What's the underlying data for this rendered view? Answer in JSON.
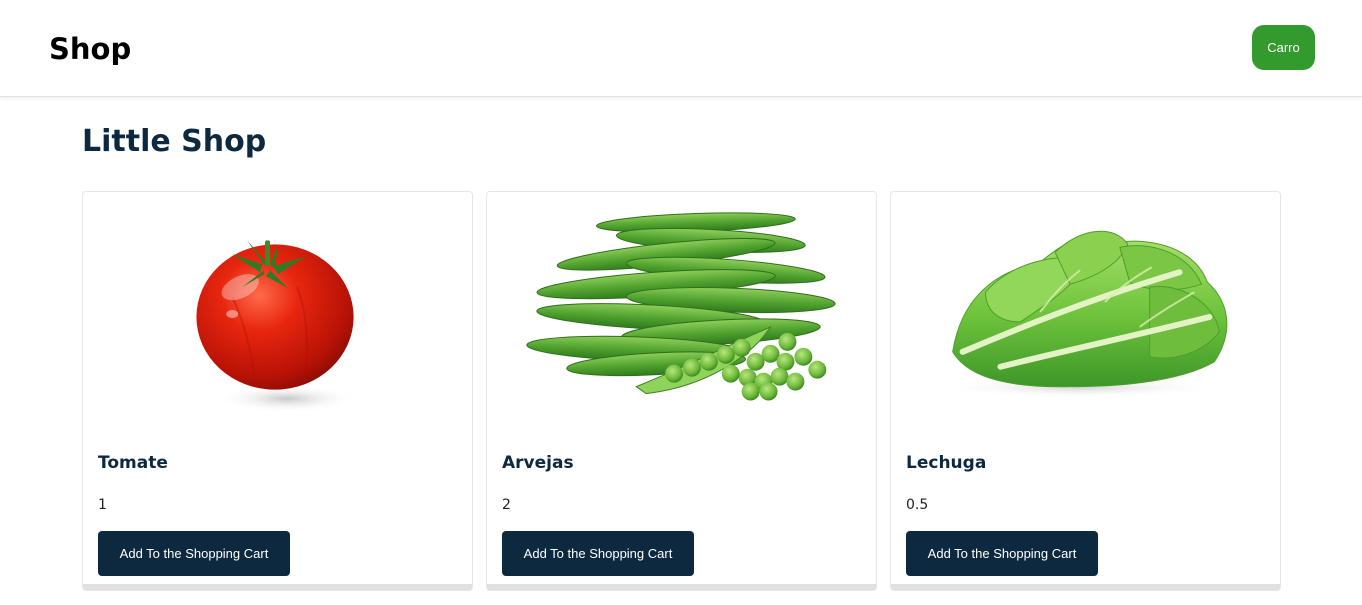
{
  "navbar": {
    "brand": "Shop",
    "cart_label": "Carro",
    "cart_color": "#339a2d"
  },
  "main": {
    "title": "Little Shop"
  },
  "products": [
    {
      "name": "Tomate",
      "price": "1",
      "image": "tomato-image",
      "button_label": "Add To the Shopping Cart"
    },
    {
      "name": "Arvejas",
      "price": "2",
      "image": "peas-image",
      "button_label": "Add To the Shopping Cart"
    },
    {
      "name": "Lechuga",
      "price": "0.5",
      "image": "lettuce-image",
      "button_label": "Add To the Shopping Cart"
    }
  ],
  "colors": {
    "primary_dark": "#0c2940",
    "accent_green": "#339a2d"
  }
}
